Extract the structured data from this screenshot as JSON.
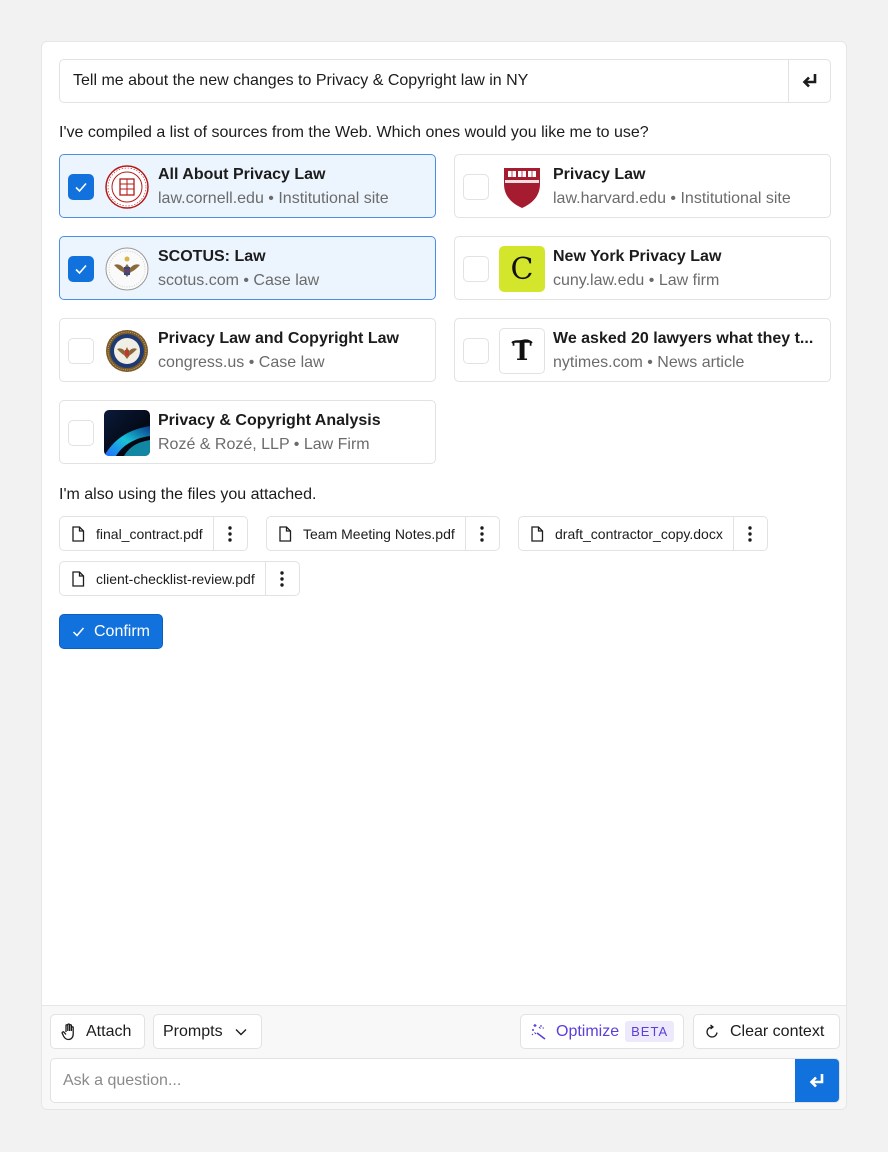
{
  "query": {
    "text": "Tell me about the new changes to Privacy & Copyright law in NY"
  },
  "intro_text": "I've compiled a list of sources from the Web. Which ones would you like me to use?",
  "sources": [
    {
      "title": "All About Privacy Law",
      "domain": "law.cornell.edu",
      "type": "Institutional site",
      "selected": true,
      "logo": "cornell-seal-icon"
    },
    {
      "title": "Privacy Law",
      "domain": "law.harvard.edu",
      "type": "Institutional site",
      "selected": false,
      "logo": "harvard-shield-icon"
    },
    {
      "title": "SCOTUS: Law",
      "domain": "scotus.com",
      "type": "Case law",
      "selected": true,
      "logo": "eagle-seal-icon"
    },
    {
      "title": "New York Privacy Law",
      "domain": "cuny.law.edu",
      "type": "Law firm",
      "selected": false,
      "logo": "letter-c-logo"
    },
    {
      "title": "Privacy Law and Copyright Law",
      "domain": "congress.us",
      "type": "Case law",
      "selected": false,
      "logo": "congress-seal-icon"
    },
    {
      "title": "We asked 20 lawyers what they t...",
      "domain": "nytimes.com",
      "type": "News article",
      "selected": false,
      "logo": "nyt-logo"
    },
    {
      "title": "Privacy & Copyright Analysis",
      "domain": "Rozé & Rozé, LLP",
      "type": "Law Firm",
      "selected": false,
      "logo": "gradient-logo"
    }
  ],
  "files_intro": "I'm also using the files you attached.",
  "files": [
    {
      "name": "final_contract.pdf"
    },
    {
      "name": "Team Meeting Notes.pdf"
    },
    {
      "name": "draft_contractor_copy.docx"
    },
    {
      "name": "client-checklist-review.pdf"
    }
  ],
  "confirm_label": "Confirm",
  "toolbar": {
    "attach_label": "Attach",
    "prompts_label": "Prompts",
    "optimize_label": "Optimize",
    "beta_label": "BETA",
    "clear_label": "Clear context"
  },
  "ask": {
    "placeholder": "Ask a question..."
  },
  "colors": {
    "accent": "#1272dd",
    "selected_bg": "#ecf4fe",
    "optimize": "#5b3fd6"
  }
}
